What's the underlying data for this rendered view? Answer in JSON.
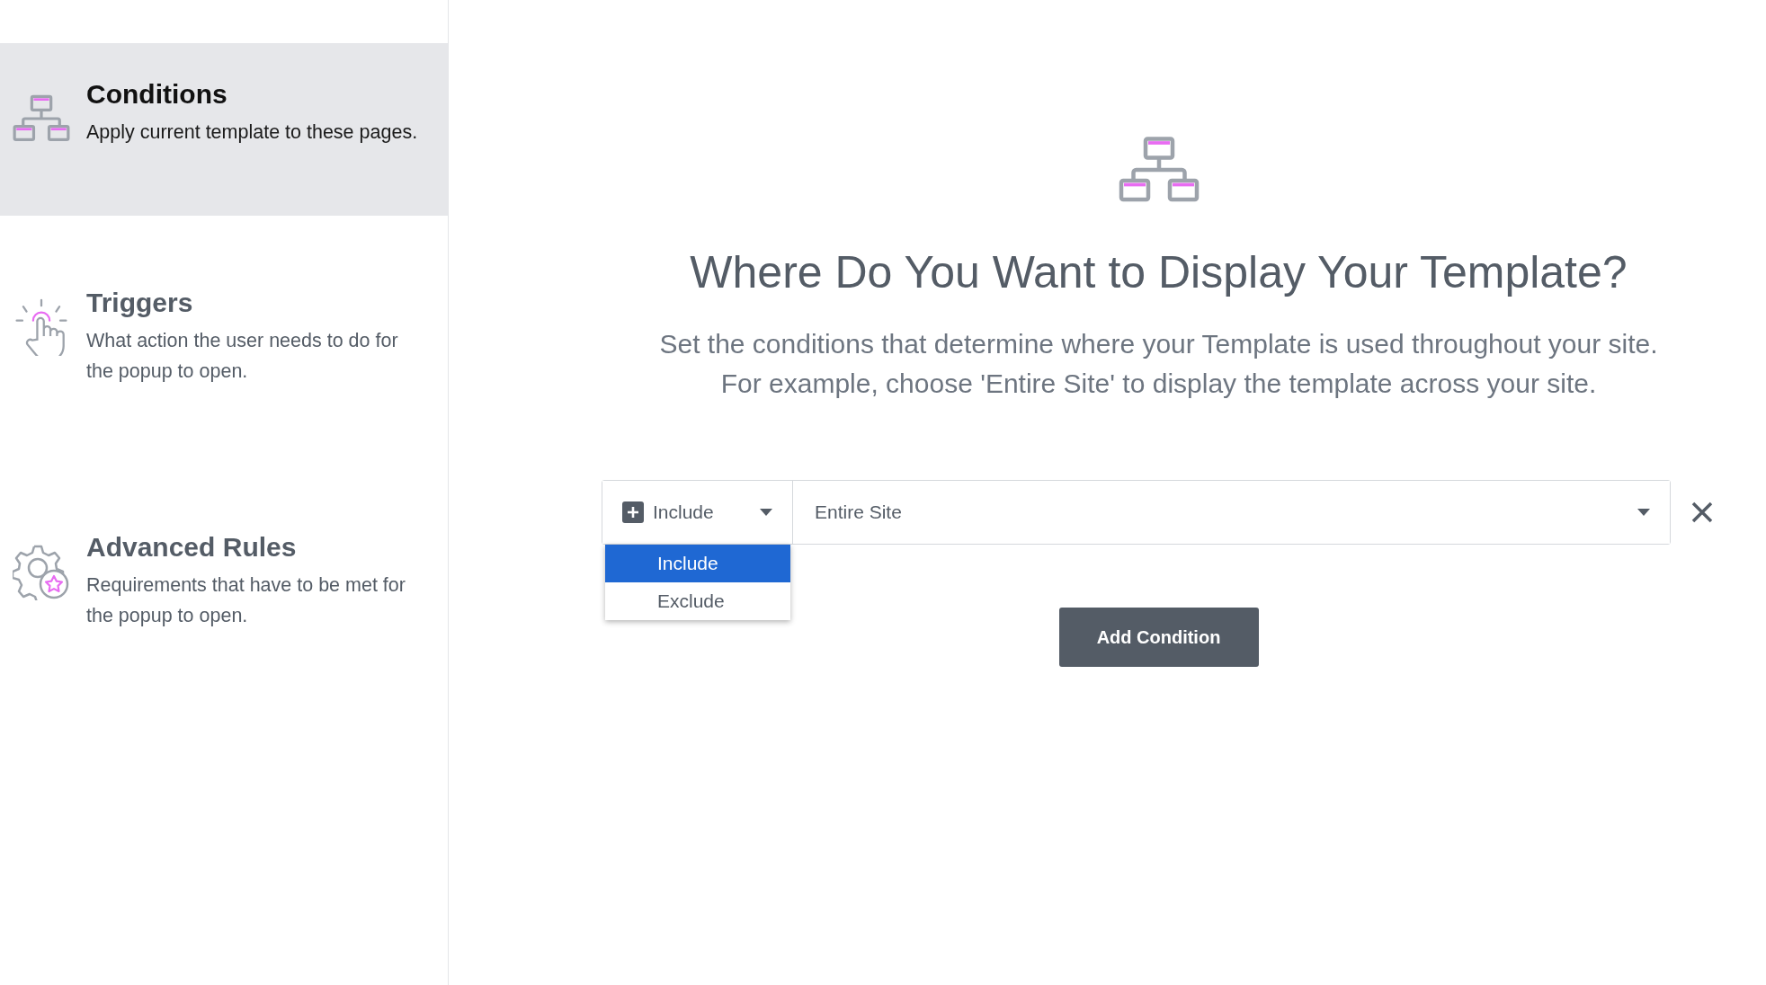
{
  "sidebar": {
    "items": [
      {
        "kind": "conditions",
        "title": "Conditions",
        "description": "Apply current template to these pages.",
        "selected": true
      },
      {
        "kind": "triggers",
        "title": "Triggers",
        "description": "What action the user needs to do for the popup to open.",
        "selected": false
      },
      {
        "kind": "advanced",
        "title": "Advanced Rules",
        "description": "Requirements that have to be met for the popup to open.",
        "selected": false
      }
    ]
  },
  "main": {
    "heading": "Where Do You Want to Display Your Template?",
    "description_lines": [
      "Set the conditions that determine where your Template is used throughout your site.",
      "For example, choose 'Entire Site' to display the template across your site."
    ],
    "condition": {
      "type_select": {
        "value": "Include",
        "expanded": true,
        "options": [
          {
            "label": "Include",
            "selected": true
          },
          {
            "label": "Exclude",
            "selected": false
          }
        ]
      },
      "scope_select": {
        "value": "Entire Site"
      }
    },
    "add_button": "Add Condition"
  }
}
